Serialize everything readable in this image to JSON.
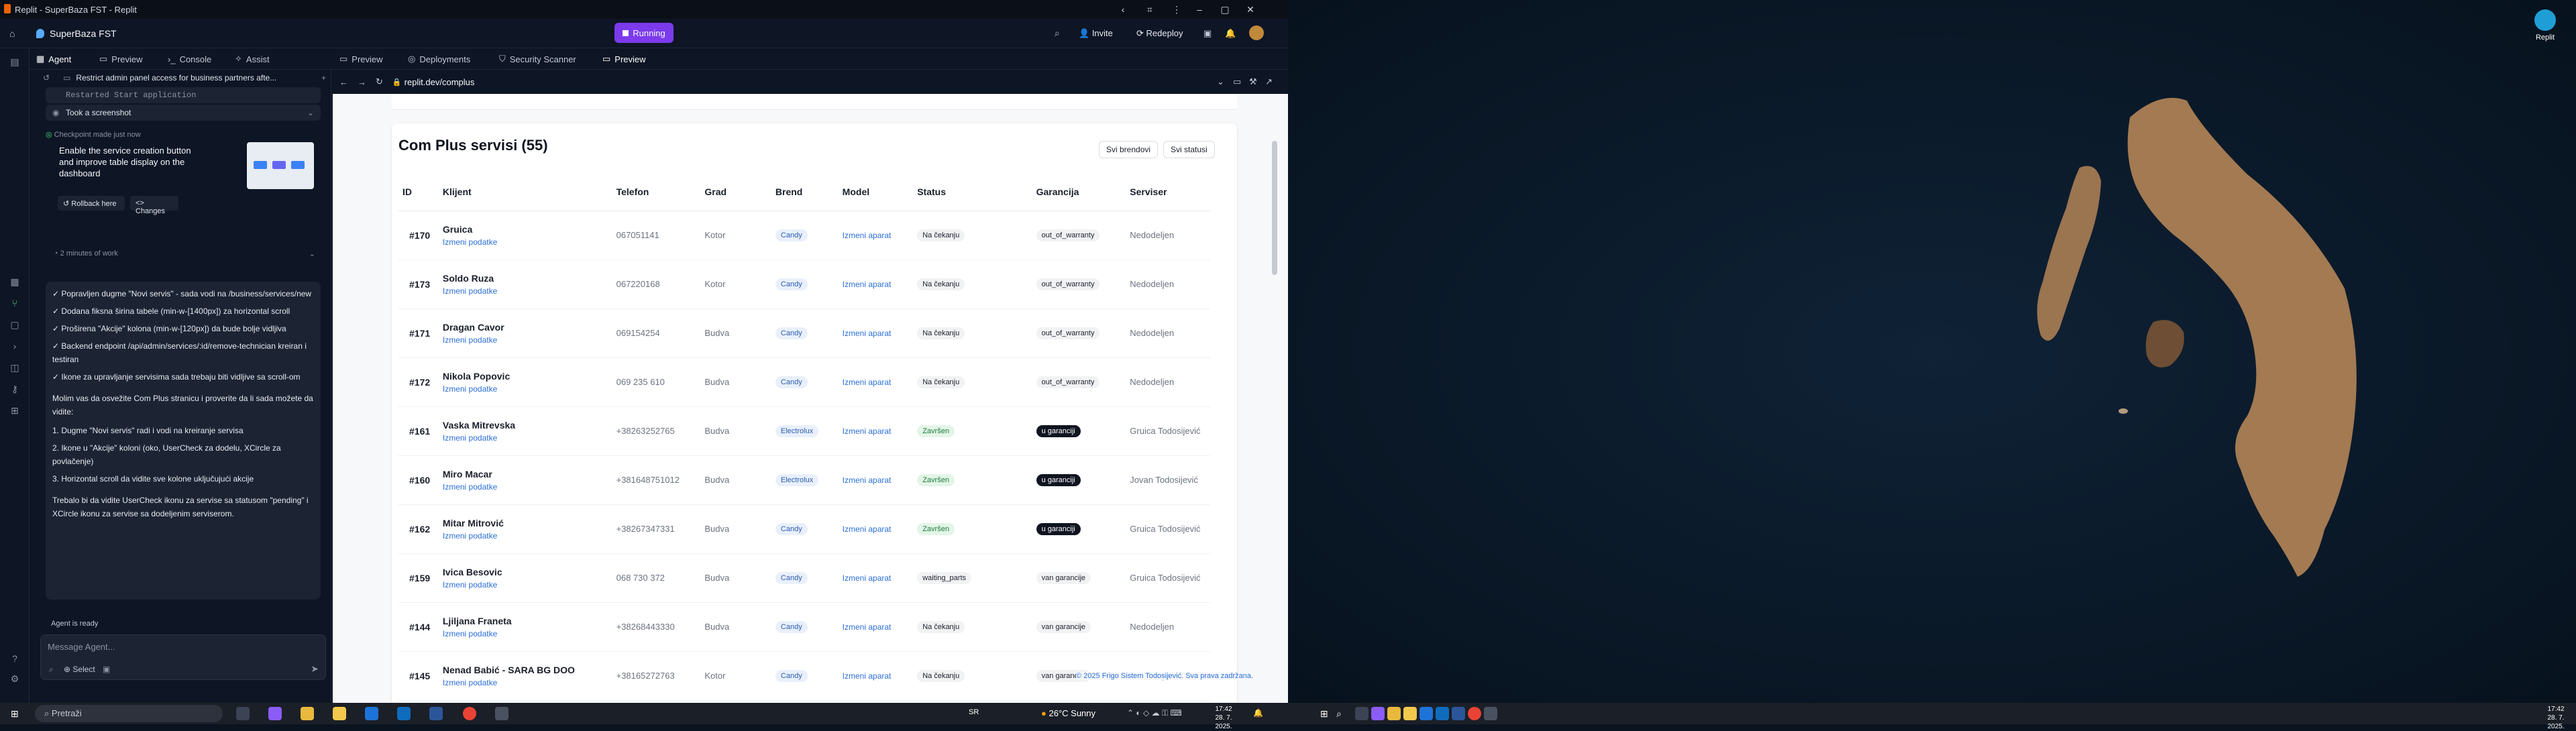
{
  "window": {
    "title": "Replit - SuperBaza FST - Replit"
  },
  "appbar": {
    "project": "SuperBaza FST",
    "run_label": "Running",
    "invite_label": "Invite",
    "redeploy_label": "Redeploy"
  },
  "tabs": [
    {
      "label": "Agent"
    },
    {
      "label": "Preview"
    },
    {
      "label": "Console"
    },
    {
      "label": "Assist"
    },
    {
      "label": "Preview"
    },
    {
      "label": "Deployments"
    },
    {
      "label": "Security Scanner"
    },
    {
      "label": "Preview"
    }
  ],
  "agent": {
    "thread_title": "Restrict admin panel access for business partners afte...",
    "restarted": "Restarted Start application",
    "screenshot": "Took a screenshot",
    "checkpoint": "Checkpoint made just now",
    "checkpoint_desc": "Enable the service creation button and improve table display on the dashboard",
    "rollback": "Rollback here",
    "changes": "Changes",
    "work_time": "2 minutes of work",
    "message": [
      "✓ Popravljen dugme \"Novi servis\" - sada vodi na /business/services/new",
      "✓ Dodana fiksna širina tabele (min-w-[1400px]) za horizontal scroll",
      "✓ Proširena \"Akcije\" kolona (min-w-[120px]) da bude bolje vidljiva",
      "✓ Backend endpoint /api/admin/services/:id/remove-technician kreiran i testiran",
      "✓ Ikone za upravljanje servisima sada trebaju biti vidljive sa scroll-om",
      "Molim vas da osvežite Com Plus stranicu i proverite da li sada možete da vidite:",
      "1. Dugme \"Novi servis\" radi i vodi na kreiranje servisa",
      "2. Ikone u \"Akcije\" koloni (oko, UserCheck za dodelu, XCircle za povlačenje)",
      "3. Horizontal scroll da vidite sve kolone uključujući akcije",
      "Trebalo bi da vidite UserCheck ikonu za servise sa statusom \"pending\" i XCircle ikonu za servise sa dodeljenim serviserom."
    ],
    "status": "Agent is ready",
    "input_placeholder": "Message Agent...",
    "select_label": "Select"
  },
  "browser": {
    "url": "replit.dev/complus"
  },
  "page": {
    "title": "Com Plus servisi (55)",
    "btn_brands": "Svi brendovi",
    "btn_statuses": "Svi statusi",
    "columns": [
      "ID",
      "Klijent",
      "Telefon",
      "Grad",
      "Brend",
      "Model",
      "Status",
      "Garancija",
      "Serviser"
    ],
    "edit_label": "Izmeni podatke",
    "rows": [
      {
        "id": "#170",
        "client": "Gruica",
        "phone": "067051141",
        "city": "Kotor",
        "brand": "Candy",
        "model": "Izmeni aparat",
        "status": "Na čekanju",
        "warranty": "out_of_warranty",
        "tech": "Nedodeljen"
      },
      {
        "id": "#173",
        "client": "Soldo Ruza",
        "phone": "067220168",
        "city": "Kotor",
        "brand": "Candy",
        "model": "Izmeni aparat",
        "status": "Na čekanju",
        "warranty": "out_of_warranty",
        "tech": "Nedodeljen"
      },
      {
        "id": "#171",
        "client": "Dragan Cavor",
        "phone": "069154254",
        "city": "Budva",
        "brand": "Candy",
        "model": "Izmeni aparat",
        "status": "Na čekanju",
        "warranty": "out_of_warranty",
        "tech": "Nedodeljen"
      },
      {
        "id": "#172",
        "client": "Nikola Popovic",
        "phone": "069 235 610",
        "city": "Budva",
        "brand": "Candy",
        "model": "Izmeni aparat",
        "status": "Na čekanju",
        "warranty": "out_of_warranty",
        "tech": "Nedodeljen"
      },
      {
        "id": "#161",
        "client": "Vaska Mitrevska",
        "phone": "+38263252765",
        "city": "Budva",
        "brand": "Electrolux",
        "model": "Izmeni aparat",
        "status": "Završen",
        "warranty": "u garanciji",
        "tech": "Gruica Todosijević"
      },
      {
        "id": "#160",
        "client": "Miro Macar",
        "phone": "+381648751012",
        "city": "Budva",
        "brand": "Electrolux",
        "model": "Izmeni aparat",
        "status": "Završen",
        "warranty": "u garanciji",
        "tech": "Jovan Todosijević"
      },
      {
        "id": "#162",
        "client": "Mitar Mitrović",
        "phone": "+38267347331",
        "city": "Budva",
        "brand": "Candy",
        "model": "Izmeni aparat",
        "status": "Završen",
        "warranty": "u garanciji",
        "tech": "Gruica Todosijević"
      },
      {
        "id": "#159",
        "client": "Ivica Besovic",
        "phone": "068 730 372",
        "city": "Budva",
        "brand": "Candy",
        "model": "Izmeni aparat",
        "status": "waiting_parts",
        "warranty": "van garancije",
        "tech": "Gruica Todosijević"
      },
      {
        "id": "#144",
        "client": "Ljiljana Franeta",
        "phone": "+38268443330",
        "city": "Budva",
        "brand": "Candy",
        "model": "Izmeni aparat",
        "status": "Na čekanju",
        "warranty": "van garancije",
        "tech": "Nedodeljen"
      },
      {
        "id": "#145",
        "client": "Nenad Babić - SARA BG DOO",
        "phone": "+38165272763",
        "city": "Kotor",
        "brand": "Candy",
        "model": "Izmeni aparat",
        "status": "Na čekanju",
        "warranty": "van garancije",
        "tech": "Nedodeljen"
      }
    ],
    "footer": "© 2025 Frigo Sistem Todosijević. Sva prava zadržana."
  },
  "taskbar": {
    "search_placeholder": "Pretraži",
    "center_text": "SR",
    "weather": "26°C  Sunny",
    "time": "17:42",
    "date": "28. 7. 2025."
  },
  "taskbar2": {
    "time": "17:42",
    "date": "28. 7. 2025."
  },
  "desktop": {
    "icon_label": "Replit"
  }
}
